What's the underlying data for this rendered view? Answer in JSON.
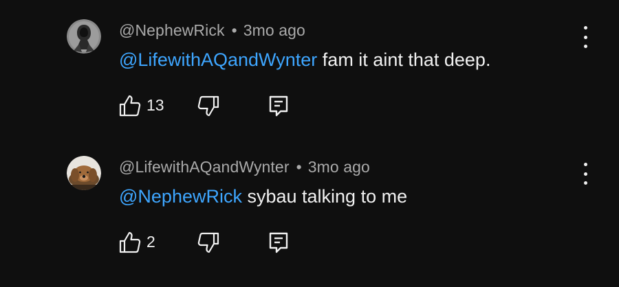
{
  "colors": {
    "background": "#0f0f0f",
    "text": "#f1f1f1",
    "meta": "#aaaaaa",
    "mention": "#3ea6ff"
  },
  "comments": [
    {
      "author": "@NephewRick",
      "separator": "•",
      "time": "3mo ago",
      "mention": "@LifewithAQandWynter",
      "body": " fam it aint that deep.",
      "likes": "13",
      "avatar_icon": "hooded-figure-avatar",
      "like_icon": "thumbs-up-icon",
      "dislike_icon": "thumbs-down-icon",
      "reply_icon": "reply-icon",
      "more_icon": "more-vertical-icon"
    },
    {
      "author": "@LifewithAQandWynter",
      "separator": "•",
      "time": "3mo ago",
      "mention": "@NephewRick",
      "body": " sybau talking to me",
      "likes": "2",
      "avatar_icon": "dog-avatar",
      "like_icon": "thumbs-up-icon",
      "dislike_icon": "thumbs-down-icon",
      "reply_icon": "reply-icon",
      "more_icon": "more-vertical-icon"
    }
  ]
}
